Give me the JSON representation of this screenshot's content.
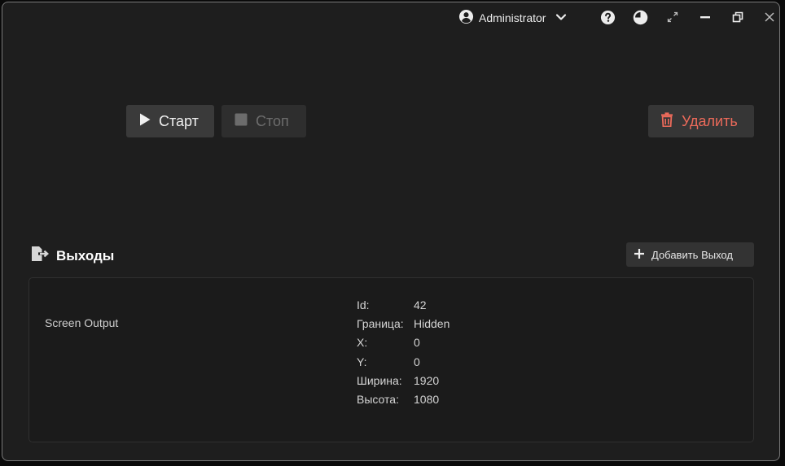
{
  "titlebar": {
    "user_name": "Administrator",
    "icons": [
      "user-circle-icon",
      "chevron-down-icon",
      "help-icon",
      "theme-icon",
      "expand-icon",
      "minimize-icon",
      "restore-icon",
      "close-icon"
    ]
  },
  "actions": {
    "start_label": "Старт",
    "stop_label": "Стоп",
    "delete_label": "Удалить"
  },
  "outputs": {
    "title": "Выходы",
    "add_label": "Добавить Выход",
    "items": [
      {
        "name": "Screen Output",
        "props": [
          {
            "key": "Id:",
            "value": "42"
          },
          {
            "key": "Граница:",
            "value": "Hidden"
          },
          {
            "key": "X:",
            "value": "0"
          },
          {
            "key": "Y:",
            "value": "0"
          },
          {
            "key": "Ширина:",
            "value": "1920"
          },
          {
            "key": "Высота:",
            "value": "1080"
          }
        ]
      }
    ]
  },
  "colors": {
    "window_bg": "#1e1e1e",
    "button_bg": "#3a3a3a",
    "delete_accent": "#ec6a5a",
    "disabled_text": "#6c6c6c"
  }
}
